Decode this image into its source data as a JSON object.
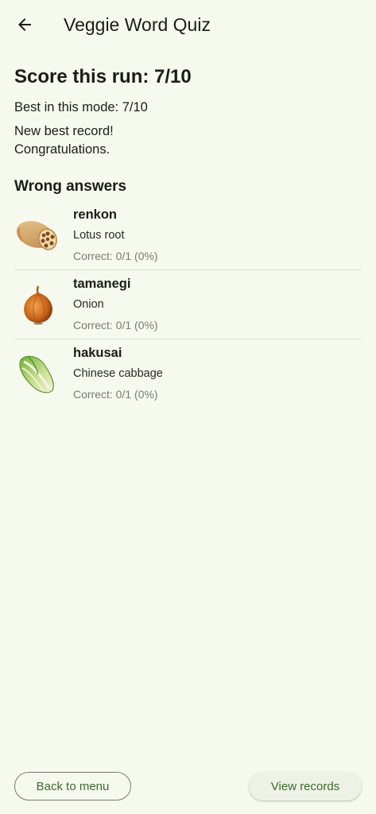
{
  "app": {
    "title": "Veggie Word Quiz",
    "back_icon": "arrow-left-icon"
  },
  "result": {
    "score_text": "Score this run: 7/10",
    "best_text": "Best in this mode: 7/10",
    "new_best_line1": "New best record!",
    "new_best_line2": "Congratulations."
  },
  "wrong": {
    "heading": "Wrong answers",
    "items": [
      {
        "word": "renkon",
        "meaning": "Lotus root",
        "correct": "Correct: 0/1 (0%)",
        "icon": "lotus-root-icon"
      },
      {
        "word": "tamanegi",
        "meaning": "Onion",
        "correct": "Correct: 0/1 (0%)",
        "icon": "onion-icon"
      },
      {
        "word": "hakusai",
        "meaning": "Chinese cabbage",
        "correct": "Correct: 0/1 (0%)",
        "icon": "chinese-cabbage-icon"
      }
    ]
  },
  "buttons": {
    "back_to_menu": "Back to menu",
    "view_records": "View records"
  },
  "colors": {
    "background": "#f6f9ee",
    "accent": "#3e6a2e",
    "muted_text": "#7a7c74"
  }
}
